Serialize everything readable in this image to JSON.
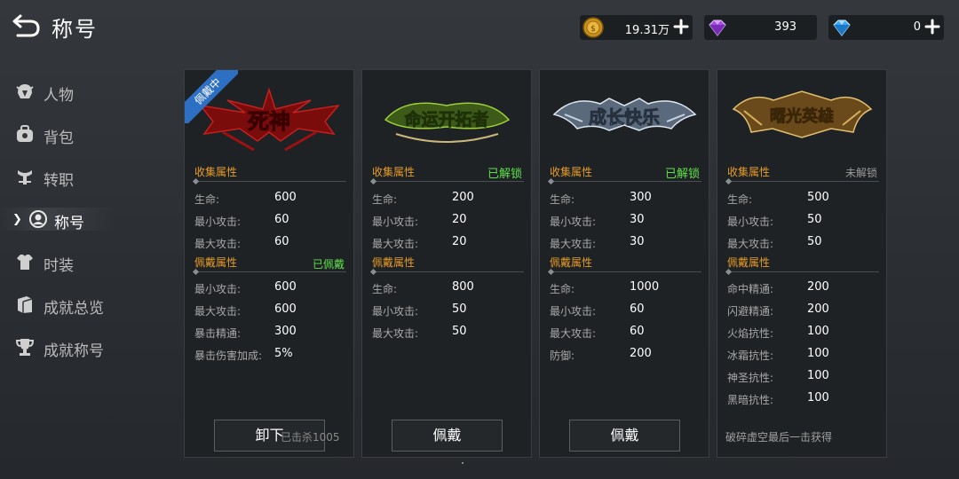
{
  "header": {
    "title": "称号"
  },
  "currencies": {
    "gold": {
      "value": "19.31万",
      "icon": "gold-coin-icon"
    },
    "purple": {
      "value": "393",
      "icon": "purple-gem-icon"
    },
    "diamond": {
      "value": "0",
      "icon": "blue-diamond-icon"
    }
  },
  "sidebar": {
    "items": [
      {
        "label": "人物",
        "icon": "helmet-icon"
      },
      {
        "label": "背包",
        "icon": "bag-icon"
      },
      {
        "label": "转职",
        "icon": "class-change-icon"
      },
      {
        "label": "称号",
        "icon": "title-icon",
        "active": true
      },
      {
        "label": "时装",
        "icon": "costume-icon"
      },
      {
        "label": "成就总览",
        "icon": "achievement-book-icon"
      },
      {
        "label": "成就称号",
        "icon": "trophy-icon"
      }
    ]
  },
  "cards": [
    {
      "emblem_text": "死神",
      "badge": "佩戴中",
      "collect_label": "收集属性",
      "collect_status": "",
      "collect": [
        {
          "k": "生命:",
          "v": "600"
        },
        {
          "k": "最小攻击:",
          "v": "60"
        },
        {
          "k": "最大攻击:",
          "v": "60"
        }
      ],
      "wear_label": "佩戴属性",
      "wear_status": "已佩戴",
      "wear": [
        {
          "k": "最小攻击:",
          "v": "600"
        },
        {
          "k": "最大攻击:",
          "v": "600"
        },
        {
          "k": "暴击精通:",
          "v": "300"
        },
        {
          "k": "暴击伤害加成:",
          "v": "5%"
        }
      ],
      "button": "卸下",
      "overlay": "已击杀1005"
    },
    {
      "emblem_text": "命运开拓者",
      "collect_label": "收集属性",
      "collect_status": "已解锁",
      "collect": [
        {
          "k": "生命:",
          "v": "200"
        },
        {
          "k": "最小攻击:",
          "v": "20"
        },
        {
          "k": "最大攻击:",
          "v": "20"
        }
      ],
      "wear_label": "佩戴属性",
      "wear_status": "",
      "wear": [
        {
          "k": "生命:",
          "v": "800"
        },
        {
          "k": "最小攻击:",
          "v": "50"
        },
        {
          "k": "最大攻击:",
          "v": "50"
        }
      ],
      "button": "佩戴"
    },
    {
      "emblem_text": "成长快乐",
      "collect_label": "收集属性",
      "collect_status": "已解锁",
      "collect": [
        {
          "k": "生命:",
          "v": "300"
        },
        {
          "k": "最小攻击:",
          "v": "30"
        },
        {
          "k": "最大攻击:",
          "v": "30"
        }
      ],
      "wear_label": "佩戴属性",
      "wear_status": "",
      "wear": [
        {
          "k": "生命:",
          "v": "1000"
        },
        {
          "k": "最小攻击:",
          "v": "60"
        },
        {
          "k": "最大攻击:",
          "v": "60"
        },
        {
          "k": "防御:",
          "v": "200"
        }
      ],
      "button": "佩戴"
    },
    {
      "emblem_text": "曙光英雄",
      "collect_label": "收集属性",
      "collect_status": "未解锁",
      "collect": [
        {
          "k": "生命:",
          "v": "500"
        },
        {
          "k": "最小攻击:",
          "v": "50"
        },
        {
          "k": "最大攻击:",
          "v": "50"
        }
      ],
      "wear_label": "佩戴属性",
      "wear_status": "",
      "wear": [
        {
          "k": "命中精通:",
          "v": "200"
        },
        {
          "k": "闪避精通:",
          "v": "200"
        },
        {
          "k": "火焰抗性:",
          "v": "100"
        },
        {
          "k": "冰霜抗性:",
          "v": "100"
        },
        {
          "k": "神圣抗性:",
          "v": "100"
        },
        {
          "k": "黑暗抗性:",
          "v": "100"
        }
      ],
      "source": "破碎虚空最后一击获得"
    }
  ],
  "colors": {
    "accent_orange": "#e59b2a",
    "unlocked_green": "#5fe04a",
    "badge_blue": "#2d6fc2"
  }
}
